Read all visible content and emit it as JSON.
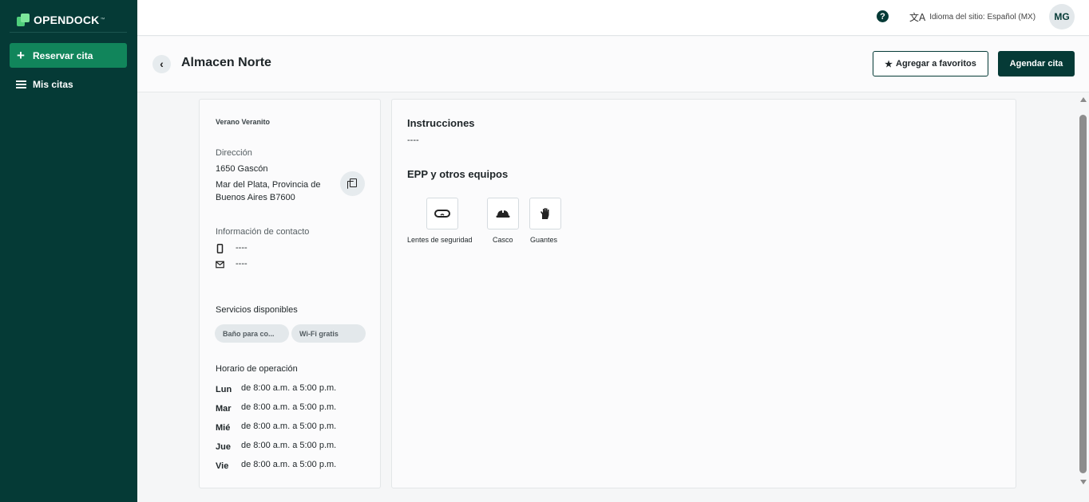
{
  "sidebar": {
    "logo_text": "OPENDOCK",
    "logo_tm": "™",
    "reserve_label": "Reservar cita",
    "my_appointments_label": "Mis citas"
  },
  "topbar": {
    "help_label": "?",
    "language_icon_glyph": "文A",
    "language_label": "Idioma del sitio: Español (MX)",
    "avatar_initials": "MG"
  },
  "header": {
    "back_glyph": "‹",
    "title": "Almacen Norte",
    "favorite_star": "★",
    "favorite_label": "Agregar a favoritos",
    "schedule_label": "Agendar cita"
  },
  "info": {
    "org_name": "Verano Veranito",
    "address_label": "Dirección",
    "address_line1": "1650 Gascón",
    "address_line2": "Mar del Plata, Provincia de",
    "address_line3": "Buenos Aires B7600",
    "contact_label": "Información de contacto",
    "phone": "----",
    "email": "----",
    "services_label": "Servicios disponibles",
    "services": [
      "Baño para co...",
      "Wi-Fi gratis"
    ],
    "hours_label": "Horario de operación",
    "schedule": [
      {
        "day": "Lun",
        "hours": "de 8:00 a.m. a 5:00 p.m."
      },
      {
        "day": "Mar",
        "hours": "de 8:00 a.m. a 5:00 p.m."
      },
      {
        "day": "Mié",
        "hours": "de 8:00 a.m. a 5:00 p.m."
      },
      {
        "day": "Jue",
        "hours": "de 8:00 a.m. a 5:00 p.m."
      },
      {
        "day": "Vie",
        "hours": "de 8:00 a.m. a 5:00 p.m."
      }
    ]
  },
  "details": {
    "instructions_title": "Instrucciones",
    "instructions_text": "----",
    "equipment_title": "EPP y otros equipos",
    "equipment": [
      {
        "label": "Lentes de seguridad",
        "icon": "safety-glasses-icon"
      },
      {
        "label": "Casco",
        "icon": "hard-hat-icon"
      },
      {
        "label": "Guantes",
        "icon": "gloves-icon"
      }
    ]
  },
  "colors": {
    "sidebar_bg": "#053a36",
    "primary_green": "#11855b",
    "primary_dark": "#053a36"
  }
}
